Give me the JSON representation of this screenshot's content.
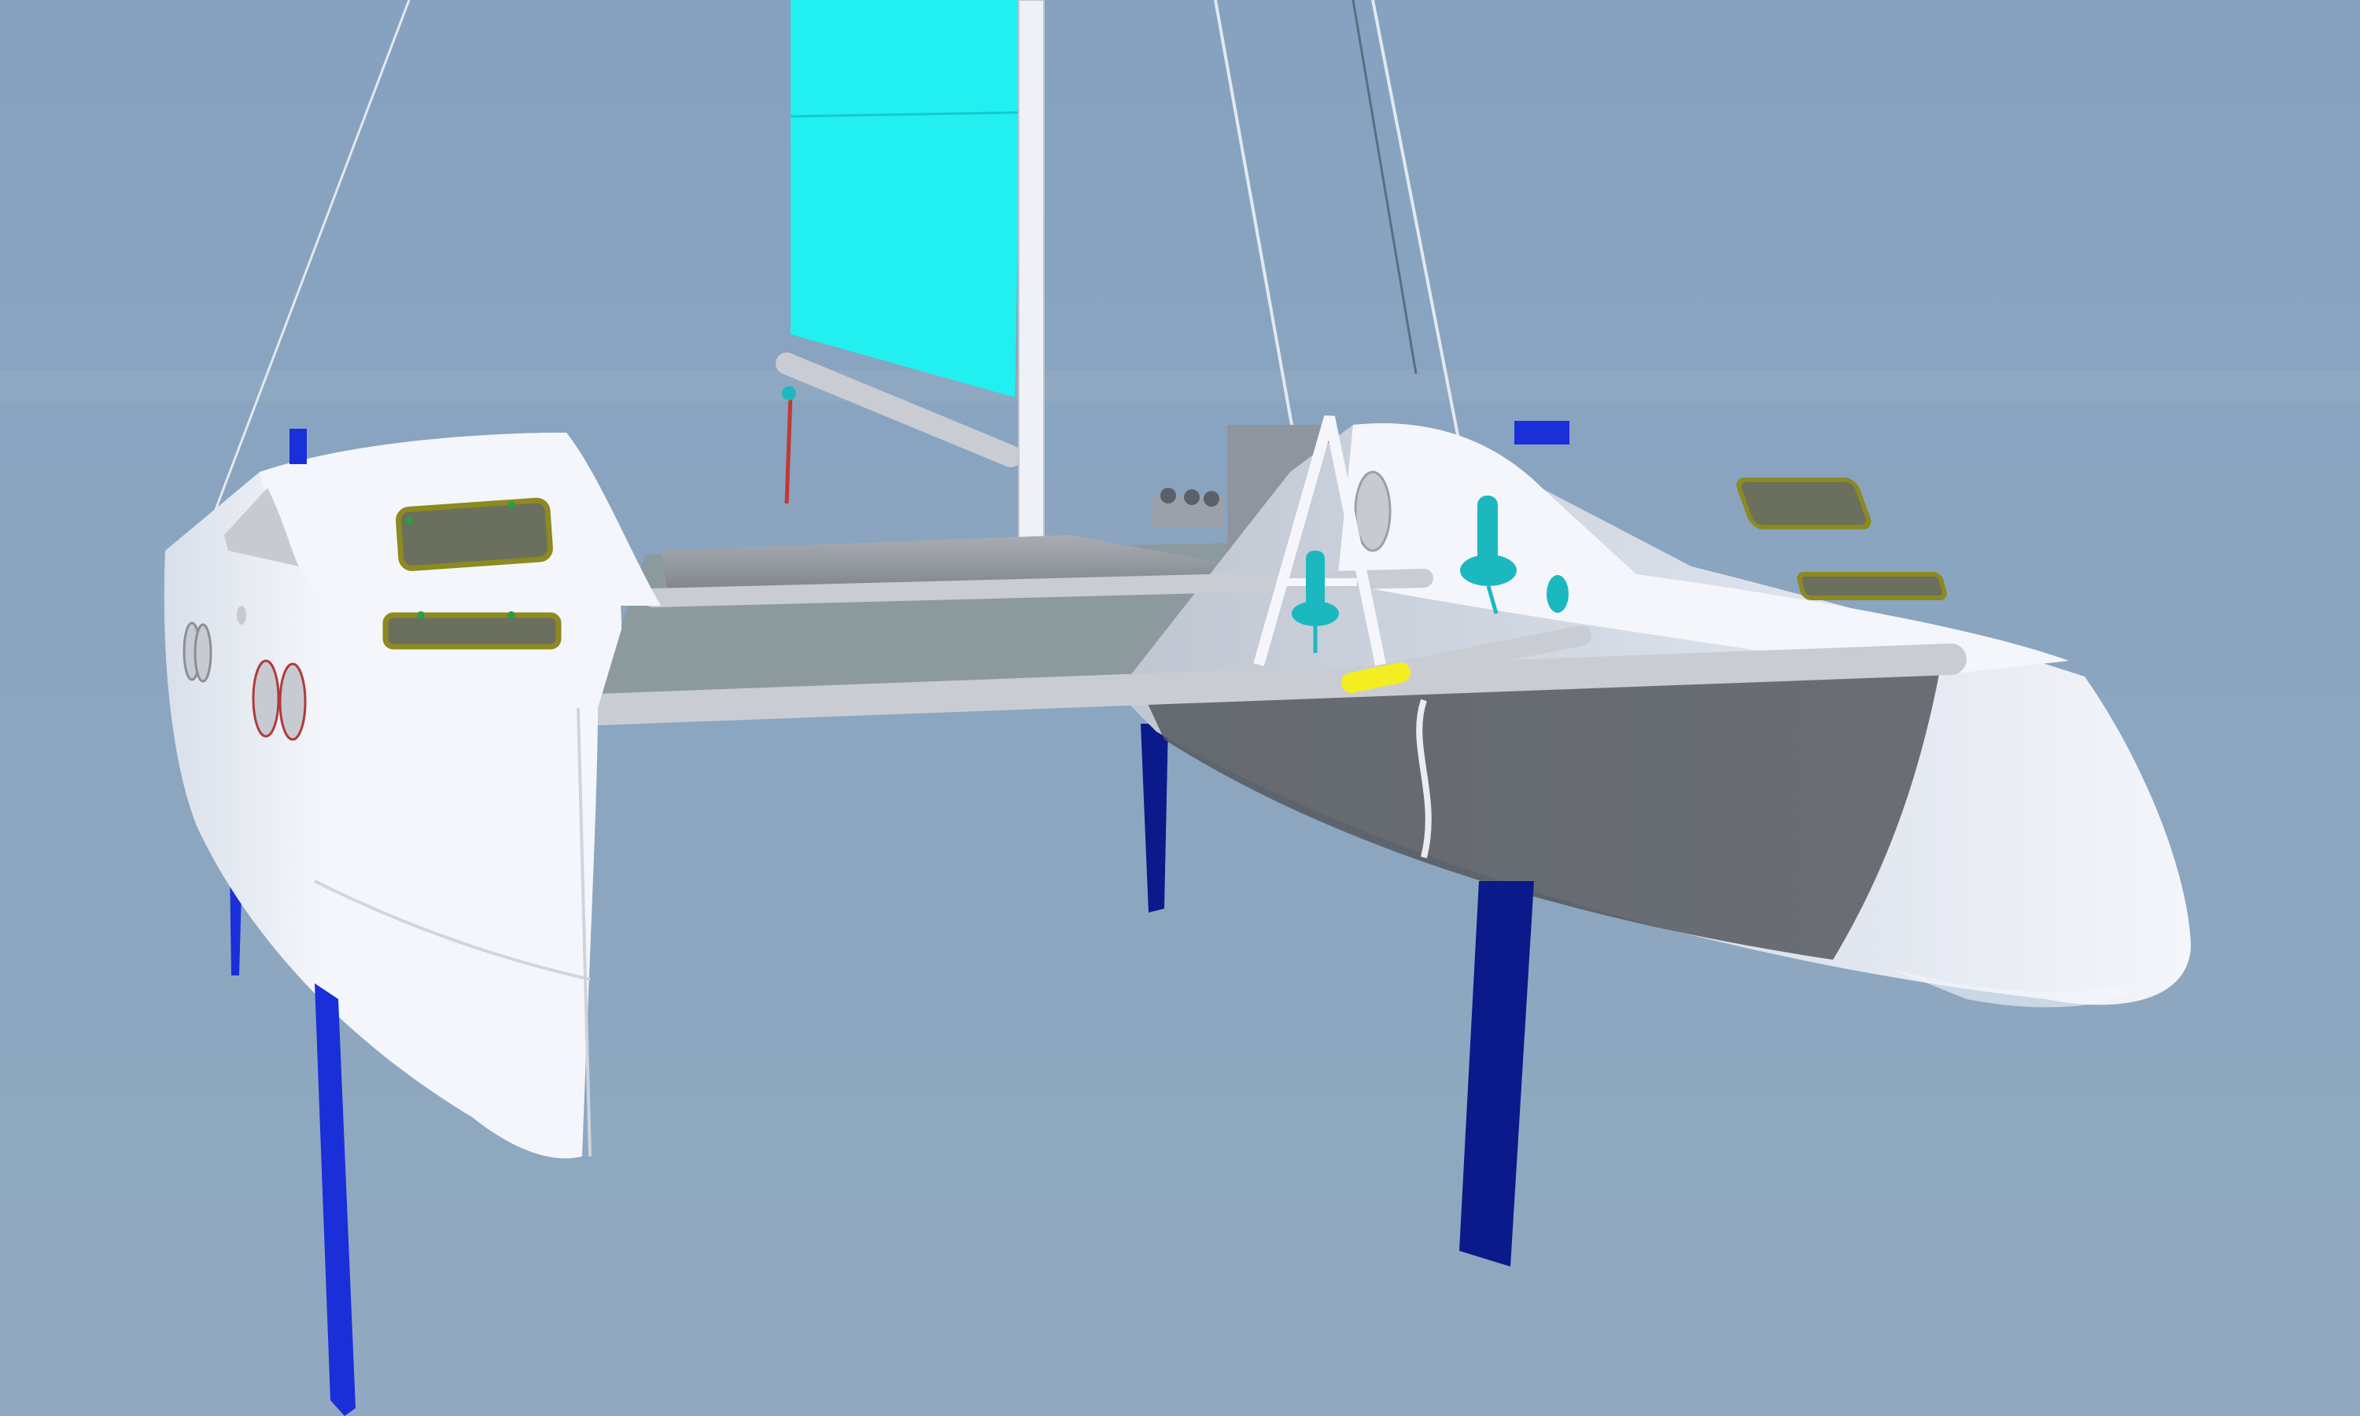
{
  "scene": {
    "subject": "catamaran-render",
    "colors": {
      "sky_top": "#86a2c0",
      "sky_bottom": "#90a9c0",
      "horizon": "#9bb2c6",
      "hull": "#f4f6fb",
      "hull_shadow": "#d9dfe9",
      "hull_dark": "#bfc6d1",
      "deck": "#a9adb3",
      "deck_dark": "#7b8088",
      "trampoline": "#8c9a9e",
      "beam": "#c9cdd3",
      "mast": "#eef1f5",
      "sail": "#22f0f0",
      "sail_edge": "#17c8cc",
      "daggerboard": "#1a2fd8",
      "daggerboard_dark": "#0a1a8a",
      "hatch": "#6b6f5e",
      "hatch_frame": "#8c8a20",
      "hatch_pin": "#2f9a4a",
      "winch": "#1cb8c0",
      "porthole": "#c7cbd1",
      "porthole_rim": "#b03a3a",
      "tiller_tip": "#f2ee22",
      "rigging": "#e4e8ee",
      "cabin_box": "#8e959e"
    }
  }
}
